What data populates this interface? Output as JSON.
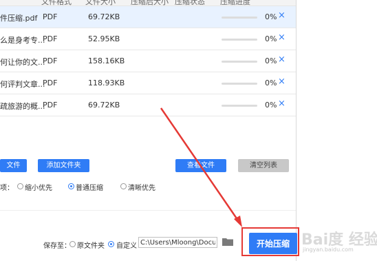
{
  "header": {
    "col_format": "文件格式",
    "col_size": "文件大小",
    "col_after": "压缩后大小",
    "col_status": "压缩状态",
    "col_progress": "压缩进度"
  },
  "files": [
    {
      "name": "件压缩.pdf",
      "format": "PDF",
      "size": "69.72KB",
      "progress": 0,
      "pct": "0%"
    },
    {
      "name": "么是身考专...",
      "format": "PDF",
      "size": "52.95KB",
      "progress": 0,
      "pct": "0%"
    },
    {
      "name": "何让你的文...",
      "format": "PDF",
      "size": "158.16KB",
      "progress": 0,
      "pct": "0%"
    },
    {
      "name": "何评判文章...",
      "format": "PDF",
      "size": "118.93KB",
      "progress": 0,
      "pct": "0%"
    },
    {
      "name": "疏旅游的概...",
      "format": "PDF",
      "size": "69.72KB",
      "progress": 0,
      "pct": "0%"
    }
  ],
  "close_icon": "×",
  "buttons": {
    "add_file": "文件",
    "add_folder": "添加文件夹",
    "view_file": "查看文件",
    "clear_list": "清空列表"
  },
  "options": {
    "label": "项：",
    "opt1": "缩小优先",
    "opt2": "普通压缩",
    "opt3": "清晰优先",
    "selected": "普通压缩"
  },
  "save": {
    "label": "保存至：",
    "opt_original": "原文件夹",
    "opt_custom": "自定义",
    "path": "C:\\Users\\Mloong\\Docume"
  },
  "start_button": "开始压缩",
  "watermark": {
    "text": "Bai度 经验",
    "sub": "jingyan.baidu.com"
  },
  "colors": {
    "accent": "#2f7cf6",
    "highlight": "#e53935"
  },
  "icons": {
    "folder": "folder-icon",
    "close": "close-icon"
  }
}
